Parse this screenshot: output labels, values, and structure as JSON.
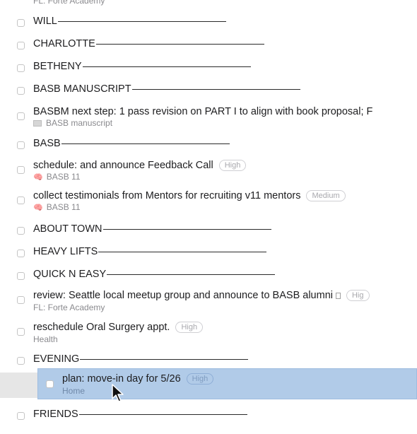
{
  "top_partial": "FL: Forte Academy",
  "rows": {
    "will": {
      "title": "WILL"
    },
    "charlotte": {
      "title": "CHARLOTTE"
    },
    "betheny": {
      "title": "BETHENY"
    },
    "basb_manuscript": {
      "title": "BASB MANUSCRIPT"
    },
    "basbm_next": {
      "title": "BASBM next step: 1 pass revision on PART I to align with book proposal; F",
      "sub": "BASB manuscript"
    },
    "basb": {
      "title": "BASB"
    },
    "schedule": {
      "title": "schedule: and announce Feedback Call",
      "tag": "High",
      "sub": "BASB 11"
    },
    "collect": {
      "title": "collect testimonials from Mentors for recruiting v11 mentors",
      "tag": "Medium",
      "sub": "BASB 11"
    },
    "about_town": {
      "title": "ABOUT TOWN"
    },
    "heavy_lifts": {
      "title": "HEAVY LIFTS"
    },
    "quick_n_easy": {
      "title": "QUICK N EASY"
    },
    "review": {
      "title": "review: Seattle local meetup group and announce to BASB alumni",
      "tag": "Hig",
      "sub": "FL: Forte Academy"
    },
    "reschedule": {
      "title": "reschedule Oral Surgery appt.",
      "tag": "High",
      "sub": "Health"
    },
    "evening": {
      "title": "EVENING"
    },
    "dragged": {
      "title": "plan: move-in day for 5/26",
      "tag": "High",
      "sub": "Home"
    },
    "friends": {
      "title": "FRIENDS"
    }
  },
  "colors": {
    "selection": "#b1cbe8",
    "text": "#1d1d1f",
    "subtext": "#8a8a8e",
    "tag": "#a8a8ad"
  },
  "icons": {
    "area_emoji": "brain-icon",
    "notes": "notes-icon",
    "attachment": "document-icon"
  }
}
